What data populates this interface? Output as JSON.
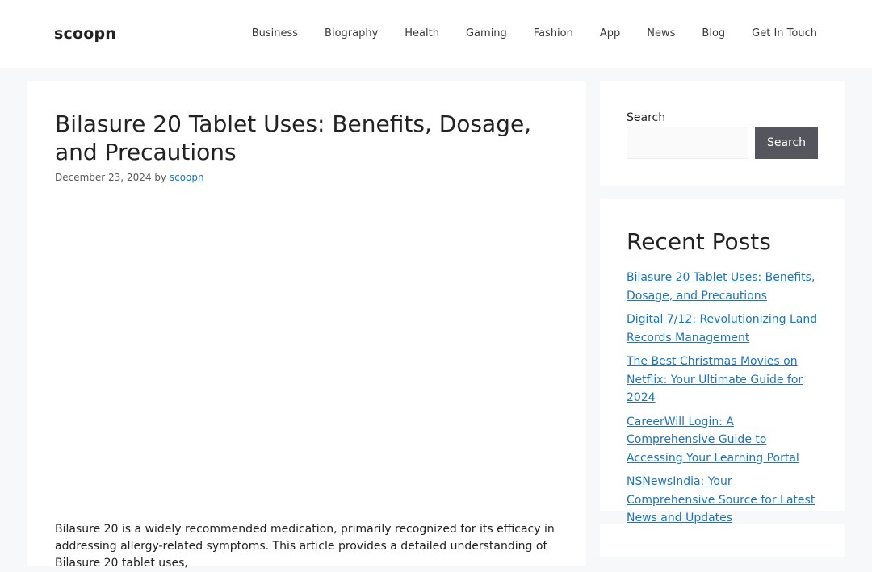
{
  "site": {
    "title": "scoopn"
  },
  "nav": {
    "items": [
      {
        "label": "Business"
      },
      {
        "label": "Biography"
      },
      {
        "label": "Health"
      },
      {
        "label": "Gaming"
      },
      {
        "label": "Fashion"
      },
      {
        "label": "App"
      },
      {
        "label": "News"
      },
      {
        "label": "Blog"
      },
      {
        "label": "Get In Touch"
      }
    ]
  },
  "post": {
    "title": "Bilasure 20 Tablet Uses: Benefits, Dosage, and Precautions",
    "date": "December 23, 2024",
    "by_label": "by",
    "author": "scoopn",
    "intro": "Bilasure 20 is a widely recommended medication, primarily recognized for its efficacy in addressing allergy-related symptoms. This article provides a detailed understanding of Bilasure 20 tablet uses,"
  },
  "search_widget": {
    "label": "Search",
    "input_value": "",
    "button_label": "Search"
  },
  "recent_posts": {
    "title": "Recent Posts",
    "items": [
      {
        "label": "Bilasure 20 Tablet Uses: Benefits, Dosage, and Precautions"
      },
      {
        "label": "Digital 7/12: Revolutionizing Land Records Management"
      },
      {
        "label": "The Best Christmas Movies on Netflix: Your Ultimate Guide for 2024"
      },
      {
        "label": "CareerWill Login: A Comprehensive Guide to Accessing Your Learning Portal"
      },
      {
        "label": "NSNewsIndia: Your Comprehensive Source for Latest News and Updates"
      }
    ]
  },
  "colors": {
    "page_background": "#f7f8f9",
    "link": "#1e73be",
    "search_button": "#55555e"
  }
}
